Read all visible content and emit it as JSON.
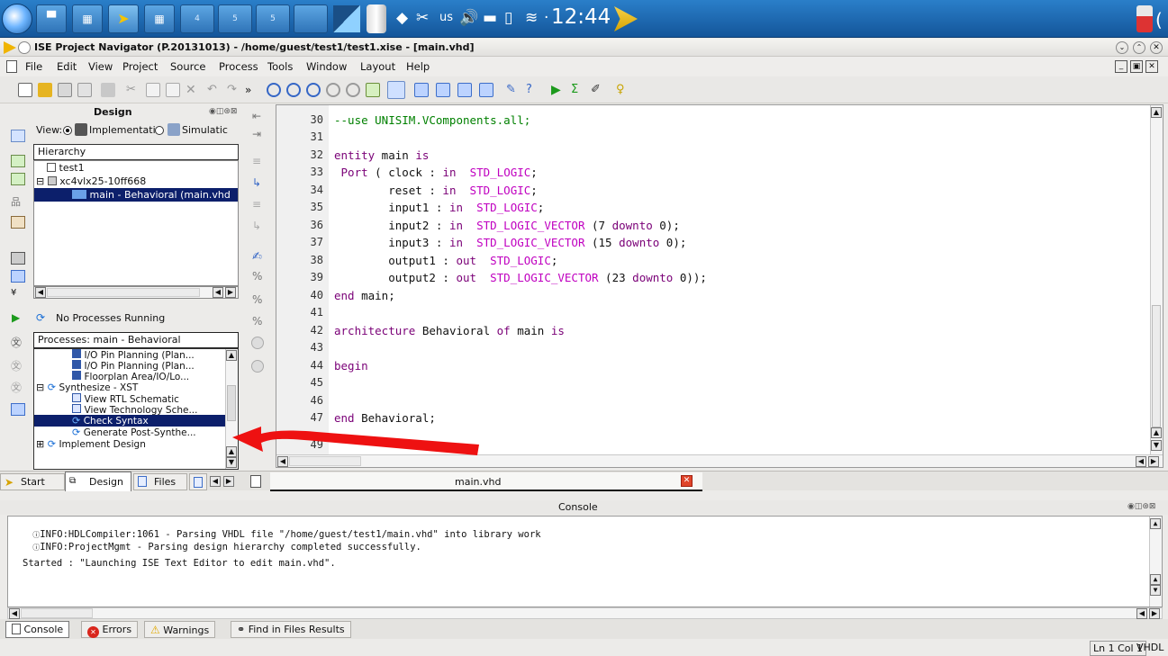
{
  "taskbar": {
    "workspace_labels": [
      "4",
      "5",
      "5"
    ],
    "keyboard_layout": "us",
    "clock": "12:44"
  },
  "window": {
    "title": "ISE Project Navigator (P.20131013) - /home/guest/test1/test1.xise - [main.vhd]"
  },
  "menu": {
    "items": [
      "File",
      "Edit",
      "View",
      "Project",
      "Source",
      "Process",
      "Tools",
      "Window",
      "Layout",
      "Help"
    ]
  },
  "design_panel": {
    "title": "Design",
    "view_label": "View:",
    "implementation_label": "Implementatic",
    "simulation_label": "Simulatic",
    "hierarchy_header": "Hierarchy",
    "hierarchy_items": [
      "test1",
      "xc4vlx25-10ff668",
      "main - Behavioral (main.vhd"
    ],
    "status": "No Processes Running",
    "processes_header": "Processes: main - Behavioral",
    "process_items": [
      "I/O Pin Planning (Plan...",
      "I/O Pin Planning (Plan...",
      "Floorplan Area/IO/Lo...",
      "Synthesize - XST",
      "View RTL Schematic",
      "View Technology Sche...",
      "Check Syntax",
      "Generate Post-Synthe...",
      "Implement Design"
    ]
  },
  "editor": {
    "line_numbers": [
      "30",
      "31",
      "32",
      "33",
      "34",
      "35",
      "36",
      "37",
      "38",
      "39",
      "40",
      "41",
      "42",
      "43",
      "44",
      "45",
      "46",
      "47",
      "49"
    ],
    "tab_label": "main.vhd"
  },
  "left_tabs": [
    "Start",
    "Design",
    "Files"
  ],
  "console": {
    "title": "Console",
    "lines": [
      "INFO:HDLCompiler:1061 - Parsing VHDL file \"/home/guest/test1/main.vhd\" into library work",
      "INFO:ProjectMgmt - Parsing design hierarchy completed successfully.",
      "Started : \"Launching ISE Text Editor to edit main.vhd\"."
    ]
  },
  "bottom_tabs": [
    "Console",
    "Errors",
    "Warnings",
    "Find in Files Results"
  ],
  "statusbar": {
    "position": "Ln 1 Col 1",
    "language": "VHDL"
  },
  "colors": {
    "keyword": "#7a0077",
    "type": "#c000c0",
    "comment": "#008000",
    "selection": "#0c1f6b",
    "annotation_arrow": "#ee1111",
    "taskbar": "#1e6ab5"
  }
}
